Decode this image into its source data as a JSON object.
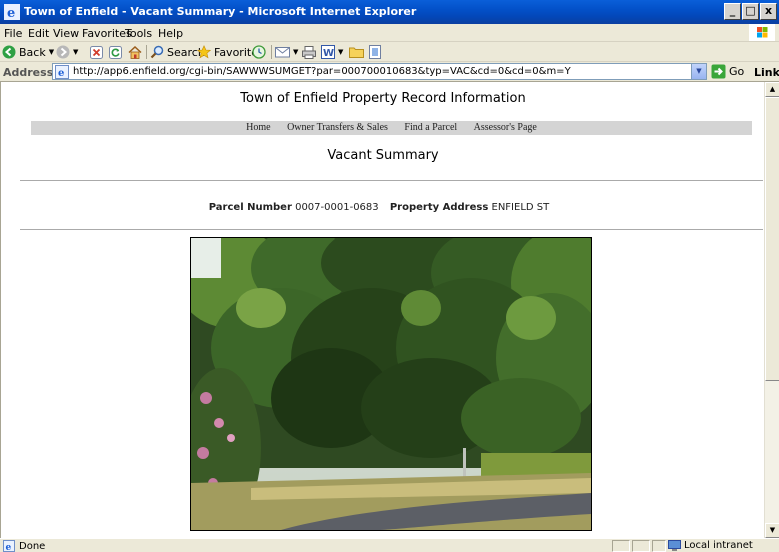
{
  "window": {
    "title": "Town of Enfield - Vacant Summary - Microsoft Internet Explorer",
    "controls": {
      "minimize": "_",
      "maximize": "□",
      "close": "x"
    }
  },
  "menu": [
    "File",
    "Edit",
    "View",
    "Favorites",
    "Tools",
    "Help"
  ],
  "toolbar": {
    "back_label": "Back",
    "search_label": "Search",
    "favorites_label": "Favorites"
  },
  "address": {
    "label": "Address",
    "url": "http://app6.enfield.org/cgi-bin/SAWWWSUMGET?par=000700010683&typ=VAC&cd=0&cd=0&m=Y",
    "go_label": "Go",
    "links_label": "Links"
  },
  "page": {
    "site_title": "Town of Enfield Property Record Information",
    "nav": [
      "Home",
      "Owner Transfers & Sales",
      "Find a Parcel",
      "Assessor's Page"
    ],
    "heading": "Vacant Summary",
    "parcel_number_label": "Parcel Number",
    "parcel_number": "0007-0001-0683",
    "property_address_label": "Property Address",
    "property_address": "ENFIELD ST"
  },
  "status": {
    "text": "Done",
    "zone": "Local intranet"
  }
}
